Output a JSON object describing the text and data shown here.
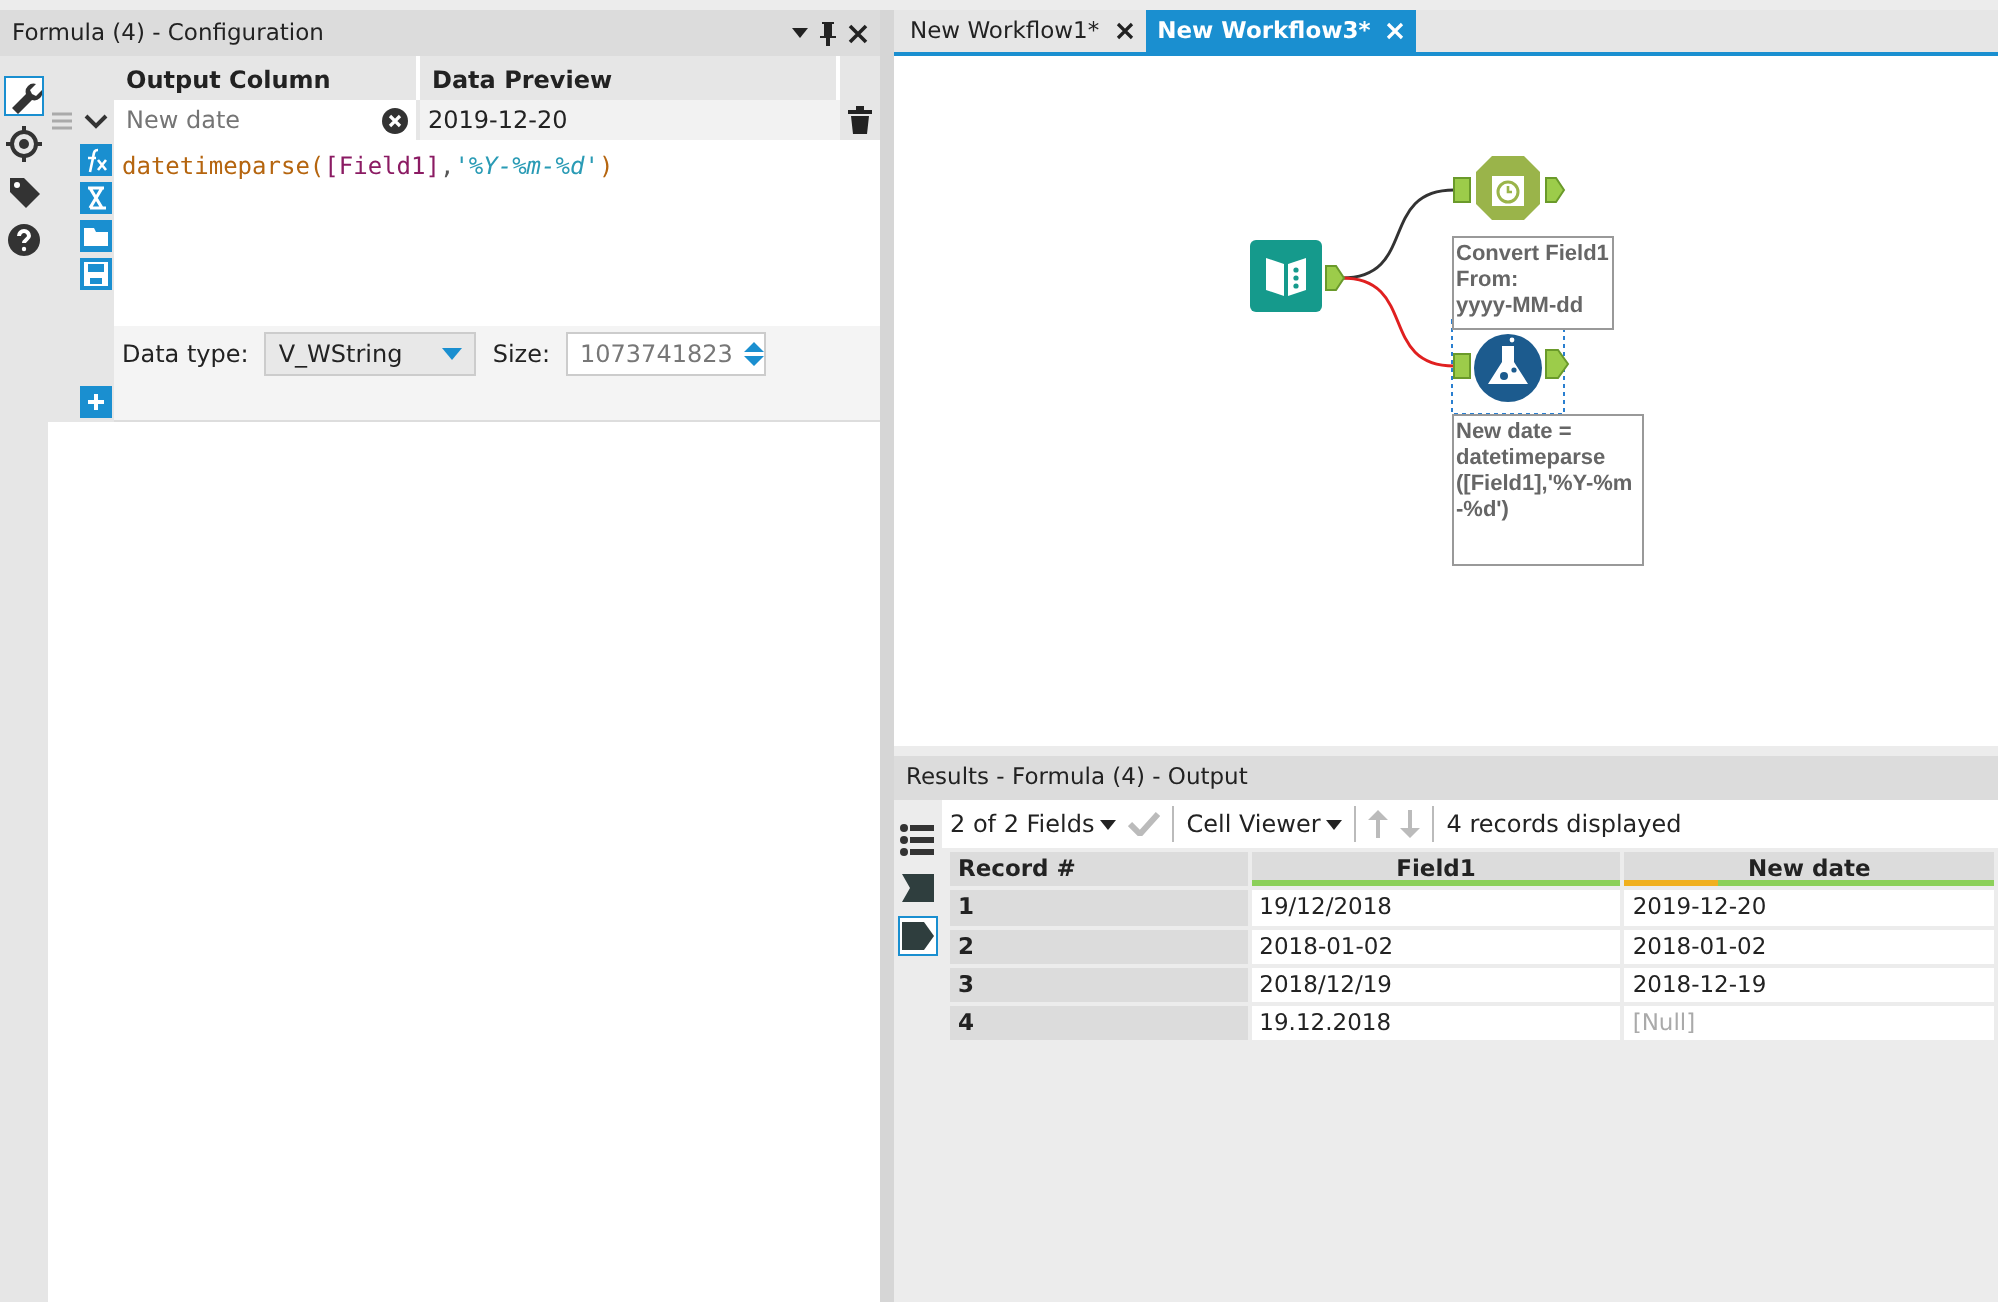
{
  "config_panel": {
    "title": "Formula (4) - Configuration",
    "rail": [
      {
        "kind": "wrench",
        "selected": true
      },
      {
        "kind": "target",
        "selected": false
      },
      {
        "kind": "tag",
        "selected": false
      },
      {
        "kind": "help",
        "selected": false
      }
    ],
    "columns": [
      "Output Column",
      "Data Preview"
    ],
    "rows": [
      {
        "placeholder": "New date",
        "preview": "2019-12-20",
        "expanded": true,
        "formula": [
          {
            "kind": "function",
            "text": "datetimeparse"
          },
          {
            "kind": "punct",
            "text": "("
          },
          {
            "kind": "field",
            "text": "[Field1]"
          },
          {
            "kind": "sep",
            "text": ","
          },
          {
            "kind": "string",
            "text": "'%Y-%m-%d'"
          },
          {
            "kind": "punct",
            "text": ")"
          }
        ],
        "data_type_label": "Data type:",
        "data_type": "V_WString",
        "size_label": "Size:",
        "size": "1073741823"
      }
    ]
  },
  "workflow": {
    "tabs": [
      {
        "label": "New Workflow1*",
        "selected": false
      },
      {
        "label": "New Workflow3*",
        "selected": true
      }
    ],
    "nodes": [
      {
        "kind": "input",
        "selected": false
      },
      {
        "kind": "datetime",
        "selected": false,
        "annotation": [
          "Convert Field1",
          "From:",
          "yyyy-MM-dd"
        ]
      },
      {
        "kind": "formula",
        "selected": true,
        "annotation": [
          "New date =",
          "datetimeparse",
          "([Field1],'%Y-%m",
          "-%d')"
        ]
      }
    ],
    "connections": [
      {
        "color": "#333333"
      },
      {
        "color": "#e02020"
      }
    ]
  },
  "results": {
    "title": "Results - Formula (4) - Output",
    "rail": [
      {
        "kind": "list",
        "selected": false
      },
      {
        "kind": "tag-left",
        "selected": false
      },
      {
        "kind": "tag-right",
        "selected": true
      }
    ],
    "fields": "2 of 2 Fields",
    "viewer": "Cell Viewer",
    "records": "4 records displayed",
    "columns": [
      {
        "label": "Record #"
      },
      {
        "label": "Field1",
        "level": 1
      },
      {
        "label": "New date",
        "level": 0.75
      }
    ],
    "rows": [
      {
        "cells": [
          {
            "text": "1",
            "null": false
          },
          {
            "text": "19/12/2018",
            "null": false
          },
          {
            "text": "2019-12-20",
            "null": false
          }
        ]
      },
      {
        "cells": [
          {
            "text": "2",
            "null": false
          },
          {
            "text": "2018-01-02",
            "null": false
          },
          {
            "text": "2018-01-02",
            "null": false
          }
        ]
      },
      {
        "cells": [
          {
            "text": "3",
            "null": false
          },
          {
            "text": "2018/12/19",
            "null": false
          },
          {
            "text": "2018-12-19",
            "null": false
          }
        ]
      },
      {
        "cells": [
          {
            "text": "4",
            "null": false
          },
          {
            "text": "19.12.2018",
            "null": false
          },
          {
            "text": "[Null]",
            "null": true
          }
        ]
      }
    ]
  }
}
